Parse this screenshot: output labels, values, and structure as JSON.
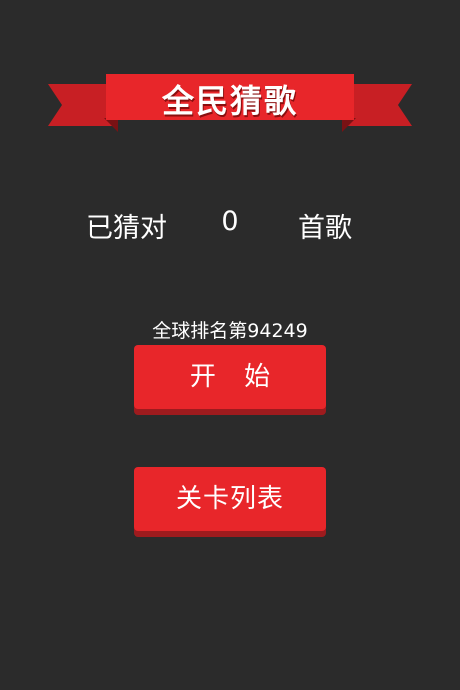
{
  "banner": {
    "title": "全民猜歌",
    "color": "#e8262a"
  },
  "score": {
    "prefix": "已猜对",
    "value": "0",
    "suffix": "首歌"
  },
  "rank": {
    "text": "全球排名第94249"
  },
  "buttons": {
    "start": "开 始",
    "levels": "关卡列表"
  },
  "colors": {
    "background": "#2b2b2b",
    "accent": "#e8262a",
    "accent_shadow": "#9e1b1e"
  }
}
